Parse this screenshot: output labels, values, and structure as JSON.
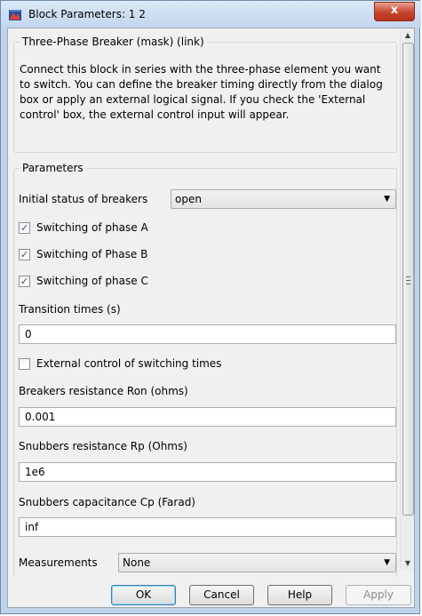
{
  "window": {
    "title": "Block Parameters: 1 2",
    "close_glyph": "x"
  },
  "mask": {
    "header": "Three-Phase Breaker (mask) (link)",
    "description": "Connect this block in series with the three-phase element you want to switch. You can define the breaker timing directly from the dialog box or apply an external logical signal. If you check  the 'External control' box, the external control input will appear."
  },
  "parameters": {
    "header": "Parameters",
    "initial_status": {
      "label": "Initial status of breakers",
      "value": "open"
    },
    "phase_a": {
      "label": "Switching of phase A",
      "checked": true
    },
    "phase_b": {
      "label": "Switching of Phase B",
      "checked": true
    },
    "phase_c": {
      "label": "Switching of phase C",
      "checked": true
    },
    "transition_times": {
      "label": "Transition times (s)",
      "value": "0"
    },
    "external_control": {
      "label": "External control of switching times",
      "checked": false
    },
    "ron": {
      "label": "Breakers resistance Ron (ohms)",
      "value": "0.001"
    },
    "rp": {
      "label": "Snubbers resistance Rp (Ohms)",
      "value": "1e6"
    },
    "cp": {
      "label": "Snubbers capacitance Cp (Farad)",
      "value": "inf"
    },
    "measurements": {
      "label": "Measurements",
      "value": "None"
    }
  },
  "buttons": {
    "ok": "OK",
    "cancel": "Cancel",
    "help": "Help",
    "apply": "Apply"
  },
  "icons": {
    "check": "✓",
    "dropdown": "▼",
    "scroll_up": "▲",
    "scroll_down": "▼"
  }
}
